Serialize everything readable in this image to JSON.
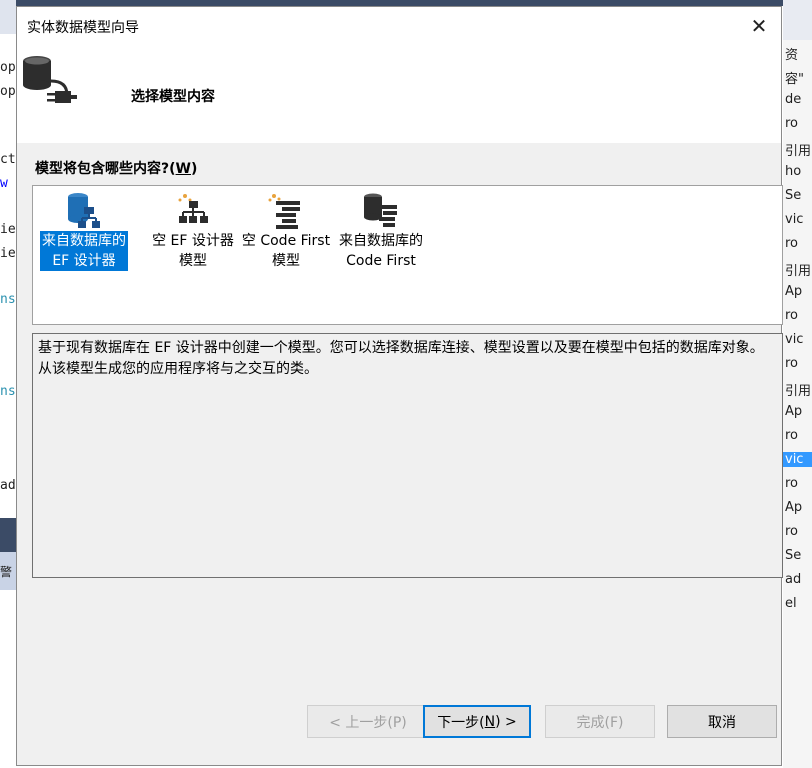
{
  "background": {
    "left_lines": [
      {
        "text": "op",
        "cls": ""
      },
      {
        "text": "op",
        "cls": ""
      },
      {
        "text": "ct",
        "cls": ""
      },
      {
        "text": "w",
        "cls": "kw"
      },
      {
        "text": "ie",
        "cls": ""
      },
      {
        "text": "ie",
        "cls": ""
      },
      {
        "text": "ns",
        "cls": "blue"
      },
      {
        "text": "ns",
        "cls": "blue"
      },
      {
        "text": "ad",
        "cls": ""
      }
    ],
    "left_panel_text": "警",
    "right_rows": [
      "资",
      "容\"",
      "de",
      "ro",
      "引用",
      "ho",
      "Se",
      "vic",
      "ro",
      "引用",
      "Ap",
      "ro",
      "vic",
      "ro",
      "引用",
      "Ap",
      "ro",
      "vic",
      "ro",
      "Ap",
      "ro",
      "Se",
      "ad",
      "el"
    ]
  },
  "dialog": {
    "title": "实体数据模型向导",
    "close_label": "✕",
    "header_title": "选择模型内容",
    "question_text": "模型将包含哪些内容?(",
    "question_key": "W",
    "question_end": ")",
    "items": [
      {
        "line1": "来自数据库的",
        "line2": "EF 设计器",
        "icon": "database-designer-icon",
        "selected": true
      },
      {
        "line1": "空 EF 设计器",
        "line2": "模型",
        "icon": "empty-designer-icon",
        "selected": false
      },
      {
        "line1": "空 Code First",
        "line2": "模型",
        "icon": "empty-code-first-icon",
        "selected": false
      },
      {
        "line1": "来自数据库的",
        "line2": "Code First",
        "icon": "database-code-first-icon",
        "selected": false
      }
    ],
    "description": "基于现有数据库在 EF 设计器中创建一个模型。您可以选择数据库连接、模型设置以及要在模型中包括的数据库对象。从该模型生成您的应用程序将与之交互的类。",
    "buttons": {
      "prev": "< 上一步(P)",
      "next_prefix": "下一步(",
      "next_key": "N",
      "next_suffix": ") >",
      "finish": "完成(F)",
      "cancel": "取消"
    }
  }
}
